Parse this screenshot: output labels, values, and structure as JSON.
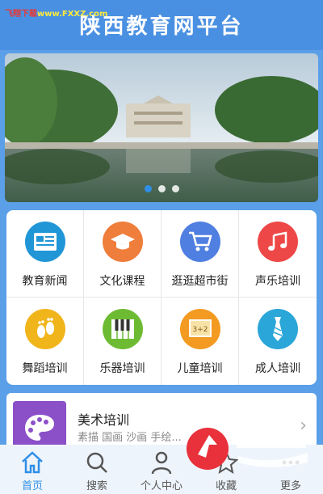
{
  "watermark": {
    "text": "飞翔下载",
    "site": "www.FXXZ.com"
  },
  "header": {
    "title": "陕西教育网平台"
  },
  "banner": {
    "dots": 3,
    "active_dot": 0
  },
  "categories": [
    {
      "label": "教育新闻",
      "color": "#2196d6",
      "icon": "newspaper-icon"
    },
    {
      "label": "文化课程",
      "color": "#ef7d3c",
      "icon": "graduation-cap-icon"
    },
    {
      "label": "逛逛超市街",
      "color": "#4f7fe0",
      "icon": "shopping-cart-icon"
    },
    {
      "label": "声乐培训",
      "color": "#ee4747",
      "icon": "music-note-icon"
    },
    {
      "label": "舞蹈培训",
      "color": "#f1b51c",
      "icon": "footprints-icon"
    },
    {
      "label": "乐器培训",
      "color": "#6dbb33",
      "icon": "piano-icon"
    },
    {
      "label": "儿童培训",
      "color": "#f39a22",
      "icon": "chalkboard-icon"
    },
    {
      "label": "成人培训",
      "color": "#2aa6d8",
      "icon": "necktie-icon"
    }
  ],
  "featured": {
    "title": "美术培训",
    "subtitle": "素描 国画 沙画 手绘...",
    "icon": "palette-icon"
  },
  "tabbar": [
    {
      "label": "首页",
      "icon": "home-icon",
      "active": true
    },
    {
      "label": "搜索",
      "icon": "search-icon",
      "active": false
    },
    {
      "label": "个人中心",
      "icon": "person-icon",
      "active": false
    },
    {
      "label": "收藏",
      "icon": "star-icon",
      "active": false
    },
    {
      "label": "更多",
      "icon": "more-icon",
      "active": false
    }
  ],
  "logo": {
    "text": "飞翔下载"
  }
}
